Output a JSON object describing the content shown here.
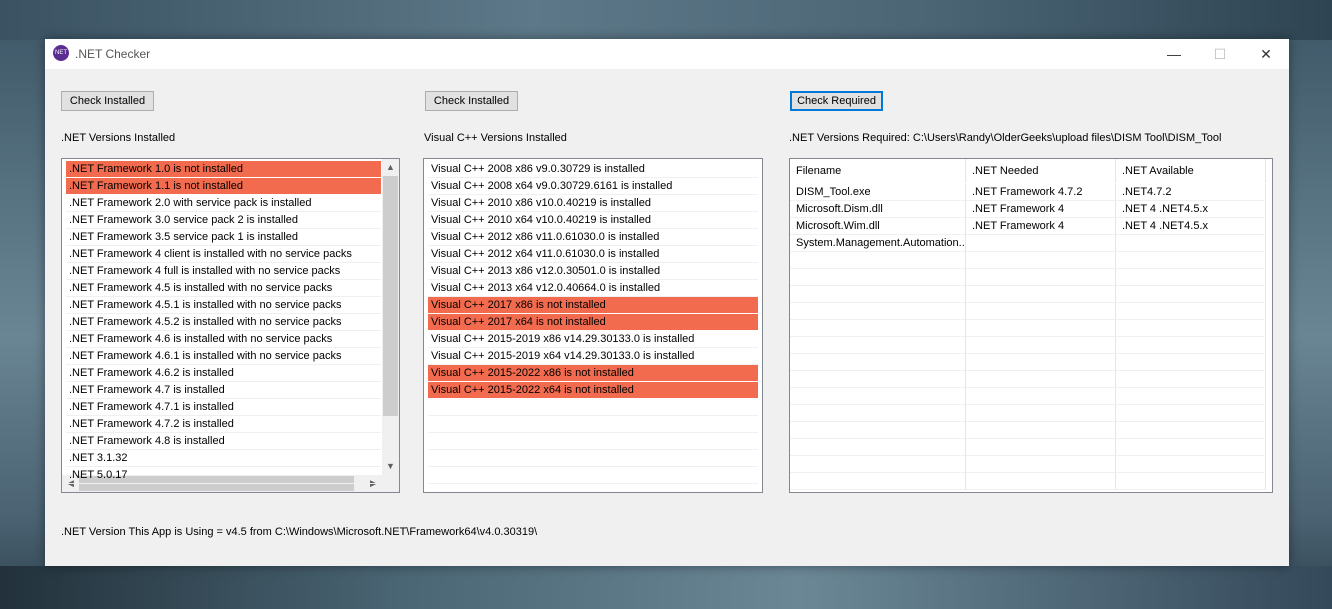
{
  "window": {
    "title": ".NET Checker",
    "icon": "net-logo-icon",
    "icon_text": "NET",
    "minimize": "—",
    "maximize": "☐",
    "close": "✕"
  },
  "net_panel": {
    "button": "Check Installed",
    "label": ".NET Versions Installed",
    "items": [
      {
        "text": ".NET Framework 1.0 is not installed",
        "status": "bad"
      },
      {
        "text": ".NET Framework 1.1 is not installed",
        "status": "bad"
      },
      {
        "text": ".NET Framework 2.0 with service pack is installed",
        "status": "ok"
      },
      {
        "text": ".NET Framework 3.0 service pack 2 is installed",
        "status": "ok"
      },
      {
        "text": ".NET Framework 3.5 service pack 1 is installed",
        "status": "ok"
      },
      {
        "text": ".NET Framework 4 client is installed with no service packs",
        "status": "ok"
      },
      {
        "text": ".NET Framework 4 full is installed with no service packs",
        "status": "ok"
      },
      {
        "text": ".NET Framework 4.5 is installed with no service packs",
        "status": "ok"
      },
      {
        "text": ".NET Framework 4.5.1 is installed with no service packs",
        "status": "ok"
      },
      {
        "text": ".NET Framework 4.5.2 is installed with no service packs",
        "status": "ok"
      },
      {
        "text": ".NET Framework 4.6 is installed with no service packs",
        "status": "ok"
      },
      {
        "text": ".NET Framework 4.6.1 is installed with no service packs",
        "status": "ok"
      },
      {
        "text": ".NET Framework 4.6.2 is installed",
        "status": "ok"
      },
      {
        "text": ".NET Framework 4.7 is installed",
        "status": "ok"
      },
      {
        "text": ".NET Framework 4.7.1 is installed",
        "status": "ok"
      },
      {
        "text": ".NET Framework 4.7.2 is installed",
        "status": "ok"
      },
      {
        "text": ".NET Framework 4.8 is installed",
        "status": "ok"
      },
      {
        "text": ".NET 3.1.32",
        "status": "ok"
      },
      {
        "text": ".NET 5.0.17",
        "status": "ok"
      }
    ]
  },
  "vc_panel": {
    "button": "Check Installed",
    "label": "Visual C++ Versions Installed",
    "items": [
      {
        "text": "Visual C++ 2008 x86 v9.0.30729 is installed",
        "status": "ok"
      },
      {
        "text": "Visual C++ 2008 x64 v9.0.30729.6161 is installed",
        "status": "ok"
      },
      {
        "text": "Visual C++ 2010 x86 v10.0.40219 is installed",
        "status": "ok"
      },
      {
        "text": "Visual C++ 2010 x64 v10.0.40219 is installed",
        "status": "ok"
      },
      {
        "text": "Visual C++ 2012 x86 v11.0.61030.0 is installed",
        "status": "ok"
      },
      {
        "text": "Visual C++ 2012 x64 v11.0.61030.0 is installed",
        "status": "ok"
      },
      {
        "text": "Visual C++ 2013 x86 v12.0.30501.0 is installed",
        "status": "ok"
      },
      {
        "text": "Visual C++ 2013 x64 v12.0.40664.0 is installed",
        "status": "ok"
      },
      {
        "text": "Visual C++ 2017 x86 is not installed",
        "status": "bad"
      },
      {
        "text": "Visual C++ 2017 x64 is not installed",
        "status": "bad"
      },
      {
        "text": "Visual C++ 2015-2019 x86 v14.29.30133.0 is installed",
        "status": "ok"
      },
      {
        "text": "Visual C++ 2015-2019 x64 v14.29.30133.0 is installed",
        "status": "ok"
      },
      {
        "text": "Visual C++ 2015-2022 x86 is not installed",
        "status": "bad"
      },
      {
        "text": "Visual C++ 2015-2022 x64 is not installed",
        "status": "bad"
      }
    ]
  },
  "req_panel": {
    "button": "Check Required",
    "label": ".NET Versions Required: C:\\Users\\Randy\\OlderGeeks\\upload files\\DISM Tool\\DISM_Tool",
    "columns": [
      "Filename",
      ".NET Needed",
      ".NET Available"
    ],
    "rows": [
      [
        "DISM_Tool.exe",
        ".NET Framework 4.7.2",
        ".NET4.7.2"
      ],
      [
        "Microsoft.Dism.dll",
        ".NET Framework 4",
        ".NET 4 .NET4.5.x"
      ],
      [
        "Microsoft.Wim.dll",
        ".NET Framework 4",
        ".NET 4 .NET4.5.x"
      ],
      [
        "System.Management.Automation....",
        "",
        ""
      ]
    ]
  },
  "footer": {
    "text": ".NET Version This App is Using = v4.5 from C:\\Windows\\Microsoft.NET\\Framework64\\v4.0.30319\\"
  },
  "colors": {
    "not_installed": "#f26b4e",
    "focus_border": "#0078d7"
  },
  "scroll": {
    "up": "▲",
    "down": "▼",
    "left": "◀",
    "right": "▶"
  }
}
